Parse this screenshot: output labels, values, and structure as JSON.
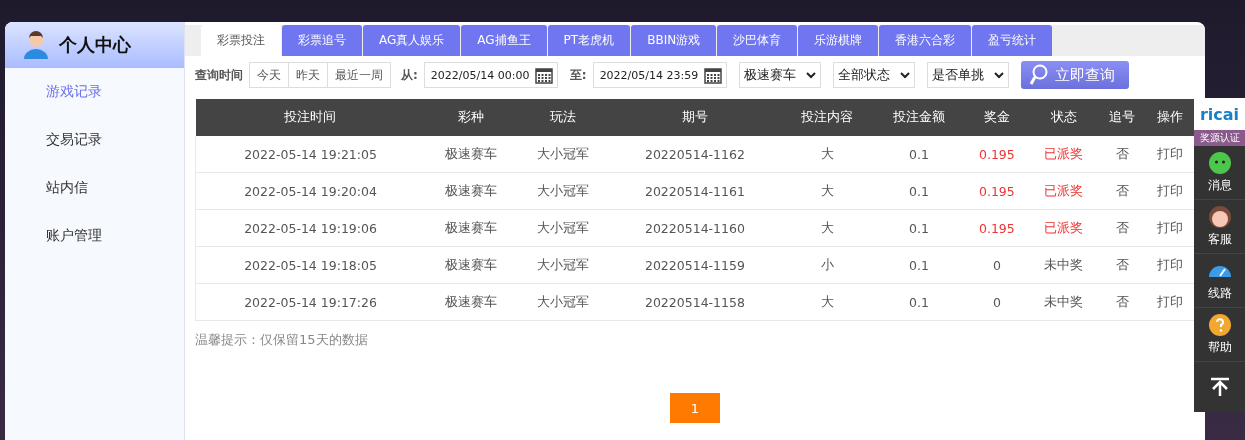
{
  "sidebar": {
    "title": "个人中心",
    "items": [
      {
        "label": "游戏记录",
        "selected": true
      },
      {
        "label": "交易记录",
        "selected": false
      },
      {
        "label": "站内信",
        "selected": false
      },
      {
        "label": "账户管理",
        "selected": false
      }
    ]
  },
  "tabs": [
    {
      "label": "彩票投注",
      "selected": true
    },
    {
      "label": "彩票追号",
      "selected": false
    },
    {
      "label": "AG真人娱乐",
      "selected": false
    },
    {
      "label": "AG捕鱼王",
      "selected": false
    },
    {
      "label": "PT老虎机",
      "selected": false
    },
    {
      "label": "BBIN游戏",
      "selected": false
    },
    {
      "label": "沙巴体育",
      "selected": false
    },
    {
      "label": "乐游棋牌",
      "selected": false
    },
    {
      "label": "香港六合彩",
      "selected": false
    },
    {
      "label": "盈亏统计",
      "selected": false
    }
  ],
  "filters": {
    "label": "查询时间",
    "ranges": [
      "今天",
      "昨天",
      "最近一周"
    ],
    "from_label": "从:",
    "from": "2022/05/14 00:00",
    "to_label": "至:",
    "to": "2022/05/14 23:59",
    "selects": [
      "极速赛车",
      "全部状态",
      "是否单挑"
    ],
    "search_button": "立即查询"
  },
  "table": {
    "columns": [
      "投注时间",
      "彩种",
      "玩法",
      "期号",
      "投注内容",
      "投注金额",
      "奖金",
      "状态",
      "追号",
      "操作"
    ],
    "rows": [
      {
        "time": "2022-05-14 19:21:05",
        "lottery": "极速赛车",
        "play": "大小冠军",
        "issue": "20220514-1162",
        "content": "大",
        "amount": "0.1",
        "prize": "0.195",
        "status": "已派奖",
        "won": true,
        "chase": "否",
        "action": "打印"
      },
      {
        "time": "2022-05-14 19:20:04",
        "lottery": "极速赛车",
        "play": "大小冠军",
        "issue": "20220514-1161",
        "content": "大",
        "amount": "0.1",
        "prize": "0.195",
        "status": "已派奖",
        "won": true,
        "chase": "否",
        "action": "打印"
      },
      {
        "time": "2022-05-14 19:19:06",
        "lottery": "极速赛车",
        "play": "大小冠军",
        "issue": "20220514-1160",
        "content": "大",
        "amount": "0.1",
        "prize": "0.195",
        "status": "已派奖",
        "won": true,
        "chase": "否",
        "action": "打印"
      },
      {
        "time": "2022-05-14 19:18:05",
        "lottery": "极速赛车",
        "play": "大小冠军",
        "issue": "20220514-1159",
        "content": "小",
        "amount": "0.1",
        "prize": "0",
        "status": "未中奖",
        "won": false,
        "chase": "否",
        "action": "打印"
      },
      {
        "time": "2022-05-14 19:17:26",
        "lottery": "极速赛车",
        "play": "大小冠军",
        "issue": "20220514-1158",
        "content": "大",
        "amount": "0.1",
        "prize": "0",
        "status": "未中奖",
        "won": false,
        "chase": "否",
        "action": "打印"
      }
    ]
  },
  "hint": "温馨提示：仅保留15天的数据",
  "pagination": [
    {
      "label": "1",
      "selected": true
    }
  ],
  "side_bar": {
    "logo": "ricai",
    "badge": "奖源认证",
    "items": [
      {
        "kind": "chat",
        "label": "消息"
      },
      {
        "kind": "service",
        "label": "客服"
      },
      {
        "kind": "route",
        "label": "线路"
      },
      {
        "kind": "help",
        "label": "帮助"
      }
    ]
  }
}
